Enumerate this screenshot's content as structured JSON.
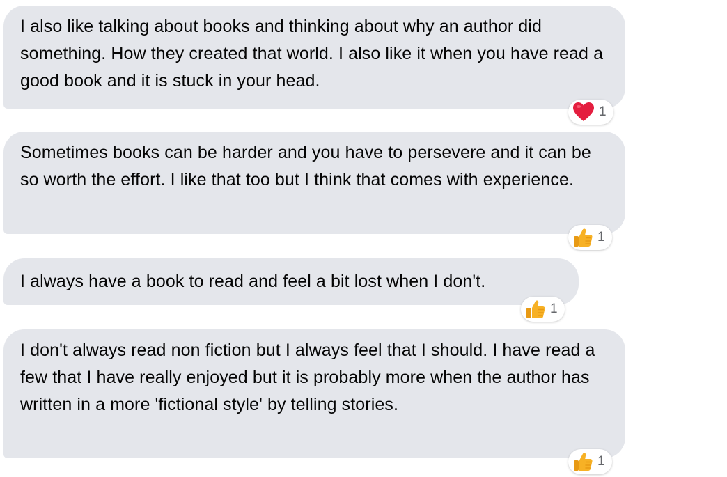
{
  "messages": [
    {
      "text": "I also like talking about books and thinking about why an author did something. How they created that world. I also like it when you have read a good book and it is stuck in your head.",
      "reaction": {
        "icon": "heart-icon",
        "count": "1"
      }
    },
    {
      "text": "Sometimes books can be harder and you have to persevere and it can be so worth the effort. I like that too but I think that comes with experience.",
      "reaction": {
        "icon": "thumbs-up-icon",
        "count": "1"
      }
    },
    {
      "text": "I always have a book to read and feel a bit lost when I don't.",
      "reaction": {
        "icon": "thumbs-up-icon",
        "count": "1"
      }
    },
    {
      "text": "I don't always read non fiction but I always feel that I should. I have read a few that I have really enjoyed but it is probably more when the author has written in a more 'fictional style' by telling stories.",
      "reaction": {
        "icon": "thumbs-up-icon",
        "count": "1"
      }
    }
  ],
  "colors": {
    "bubble_bg": "#e4e6eb",
    "text": "#050505",
    "heart": "#e41e3f",
    "thumb": "#f7b125",
    "count": "#65676b"
  }
}
